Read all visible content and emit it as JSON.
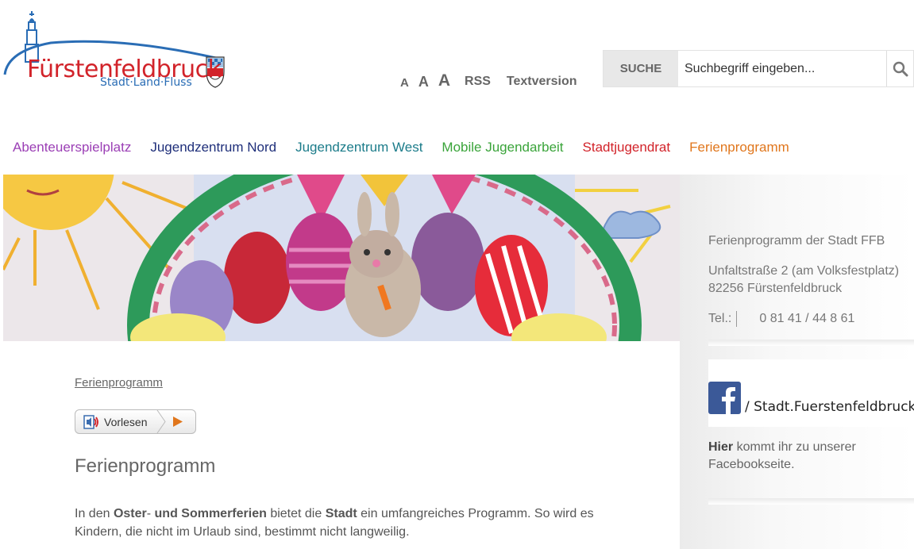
{
  "header": {
    "logo_title": "Fürstenfeldbruck",
    "logo_subtitle": "Stadt·Land·Fluss",
    "font_sizes": [
      "A",
      "A",
      "A"
    ],
    "rss_label": "RSS",
    "textversion_label": "Textversion"
  },
  "search": {
    "label": "SUCHE",
    "placeholder": "Suchbegriff eingeben..."
  },
  "nav": [
    {
      "label": "Abenteuerspielplatz",
      "color": "#9b3fb5"
    },
    {
      "label": "Jugendzentrum Nord",
      "color": "#1f2f7a"
    },
    {
      "label": "Jugendzentrum West",
      "color": "#1c7c8a"
    },
    {
      "label": "Mobile Jugendarbeit",
      "color": "#3aa43a"
    },
    {
      "label": "Stadtjugendrat",
      "color": "#d2232a"
    },
    {
      "label": "Ferienprogramm",
      "color": "#e0761c"
    }
  ],
  "sidebar": {
    "org_name": "Ferienprogramm der Stadt FFB",
    "address_line1": "Unfaltstraße 2 (am Volksfestplatz)",
    "address_line2": "82256 Fürstenfeldbruck",
    "tel_label": "Tel.:",
    "tel_number": "0 81 41 / 44 8 61",
    "facebook_handle": "/ Stadt.Fuerstenfeldbruck",
    "facebook_here": "Hier",
    "facebook_text": "kommt ihr zu unserer Facebookseite."
  },
  "content": {
    "breadcrumb": "Ferienprogramm",
    "vorlesen_label": "Vorlesen",
    "title": "Ferienprogramm",
    "para_parts": [
      "In den ",
      "Oster",
      "- ",
      "und Sommerferien",
      " bietet die ",
      "Stadt",
      " ein umfangreiches Programm. So wird es Kindern, die nicht im Urlaub sind, bestimmt nicht langweilig."
    ]
  }
}
